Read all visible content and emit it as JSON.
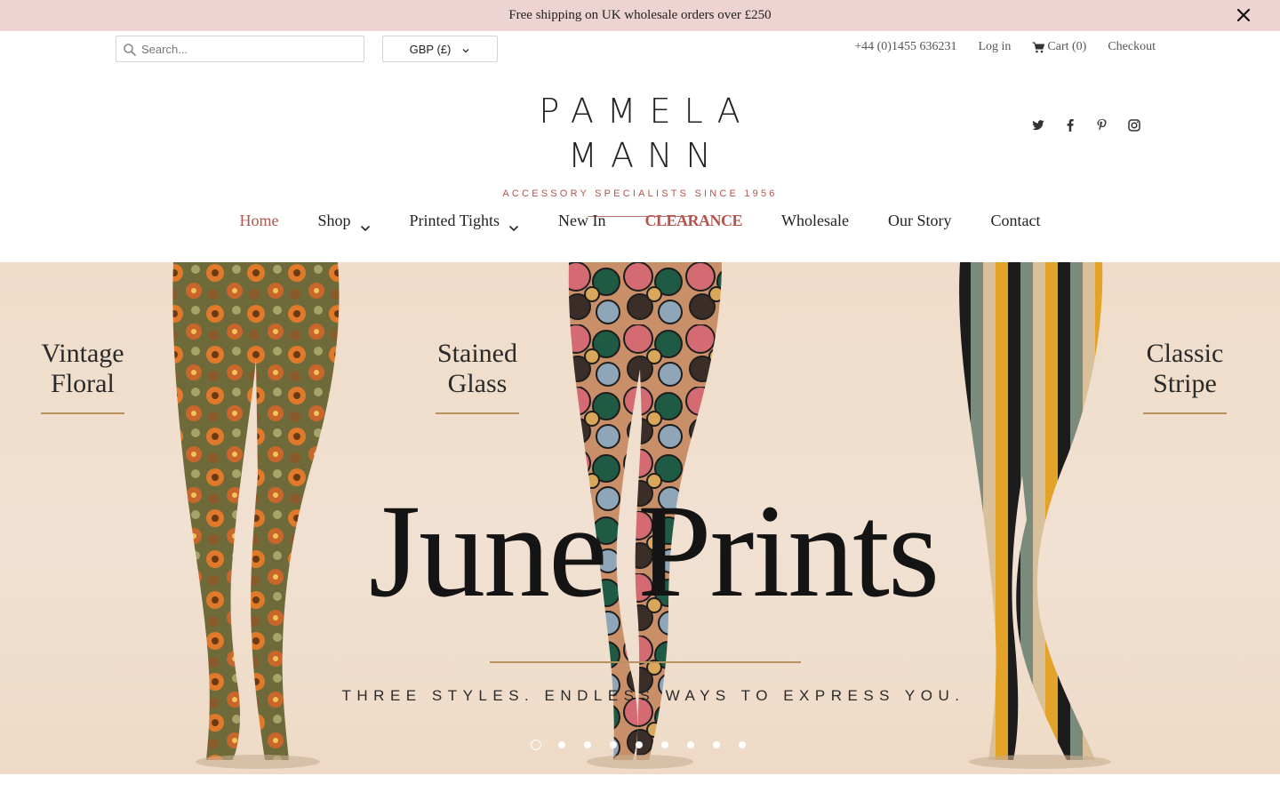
{
  "announcement": {
    "text": "Free shipping on UK wholesale orders over £250",
    "close_icon": "close-icon"
  },
  "search": {
    "placeholder": "Search...",
    "value": "",
    "icon": "search-icon"
  },
  "currency": {
    "selected": "GBP (£)",
    "icon": "chevron-down-icon"
  },
  "utility": {
    "phone": "+44 (0)1455 636231",
    "login": "Log in",
    "cart": "Cart (0)",
    "cart_icon": "cart-icon",
    "checkout": "Checkout"
  },
  "logo": {
    "name": "PAMELA MANN",
    "tagline": "ACCESSORY SPECIALISTS SINCE 1956"
  },
  "social": [
    "twitter-icon",
    "facebook-icon",
    "pinterest-icon",
    "instagram-icon"
  ],
  "nav": {
    "items": [
      {
        "label": "Home",
        "active": true
      },
      {
        "label": "Shop",
        "dropdown": true
      },
      {
        "label": "Printed Tights",
        "dropdown": true
      },
      {
        "label": "New In"
      },
      {
        "label": "CLEARANCE",
        "highlight": true
      },
      {
        "label": "Wholesale"
      },
      {
        "label": "Our Story"
      },
      {
        "label": "Contact"
      }
    ]
  },
  "hero": {
    "labels": [
      {
        "line1": "Vintage",
        "line2": "Floral"
      },
      {
        "line1": "Stained",
        "line2": "Glass"
      },
      {
        "line1": "Classic",
        "line2": "Stripe"
      }
    ],
    "title": "June Prints",
    "tagline": "THREE STYLES. ENDLESS WAYS TO EXPRESS YOU.",
    "slide_count": 9,
    "active_slide": 1
  },
  "colors": {
    "announcement_bg": "#edd3d1",
    "accent": "#b5534c",
    "gold_rule": "#b8925e"
  }
}
